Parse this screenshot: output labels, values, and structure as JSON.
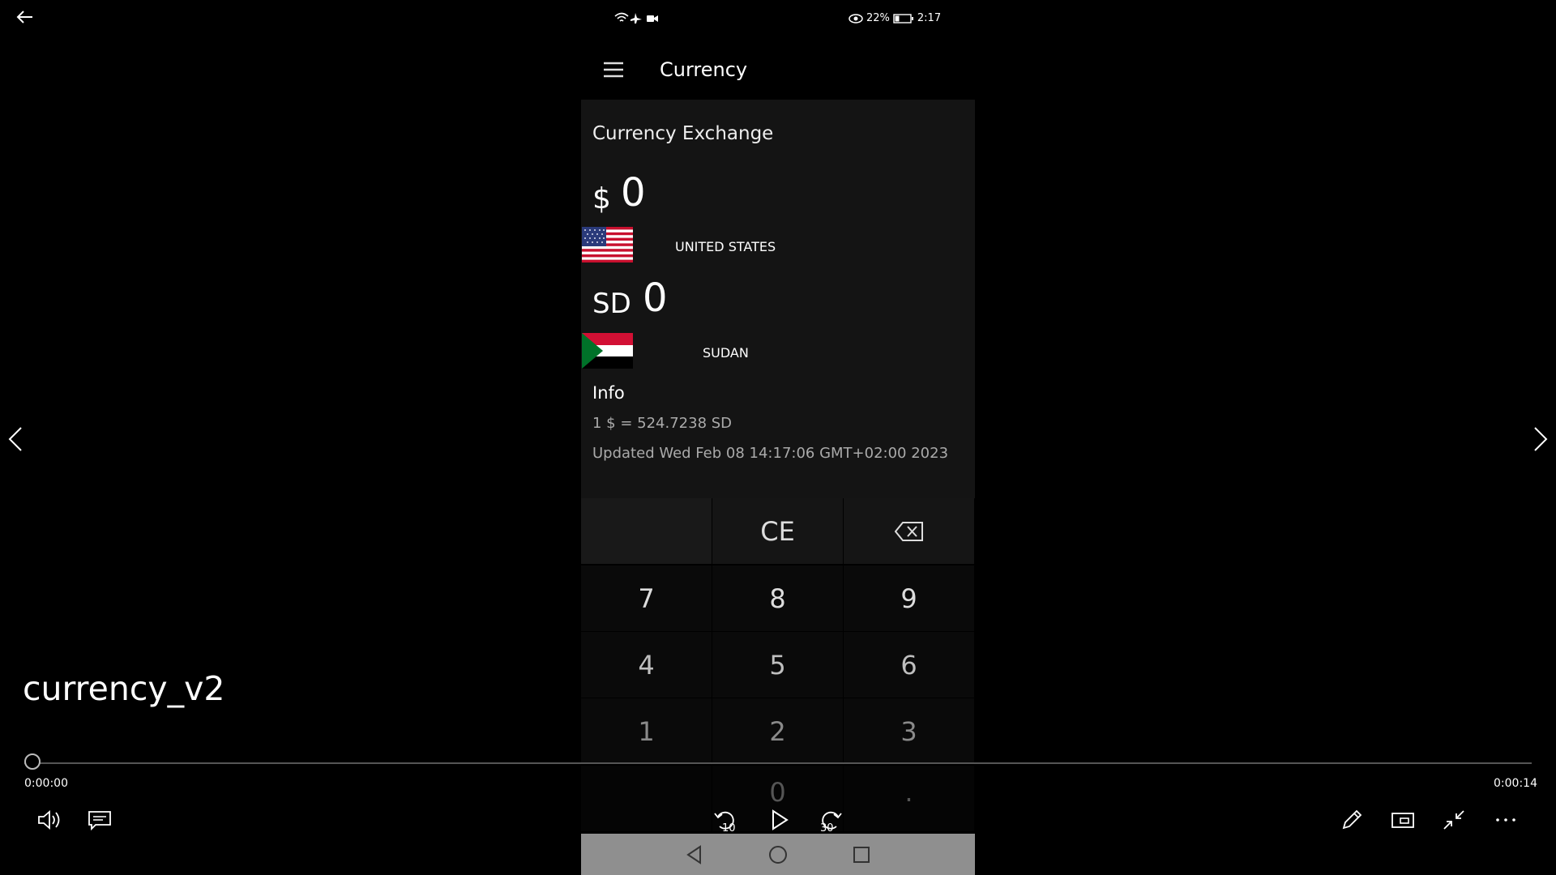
{
  "player": {
    "video_title": "currency_v2",
    "time_current": "0:00:00",
    "time_total": "0:00:14",
    "progress": 0,
    "rewind_seconds": "10",
    "forward_seconds": "30"
  },
  "status_bar": {
    "battery_percent": "22%",
    "clock": "2:17"
  },
  "app": {
    "title": "Currency",
    "card_title": "Currency Exchange",
    "from": {
      "symbol": "$",
      "amount": "0",
      "country": "UNITED STATES"
    },
    "to": {
      "symbol": "SD",
      "amount": "0",
      "country": "SUDAN"
    },
    "info": {
      "title": "Info",
      "rate": "1 $ = 524.7238 SD",
      "updated": "Updated Wed Feb 08 14:17:06 GMT+02:00 2023"
    }
  },
  "keypad": {
    "ce": "CE",
    "k7": "7",
    "k8": "8",
    "k9": "9",
    "k4": "4",
    "k5": "5",
    "k6": "6",
    "k1": "1",
    "k2": "2",
    "k3": "3",
    "k0": "0",
    "dot": "."
  },
  "colors": {
    "accent_gray": "#8f8f8f",
    "card_bg": "#141414"
  }
}
